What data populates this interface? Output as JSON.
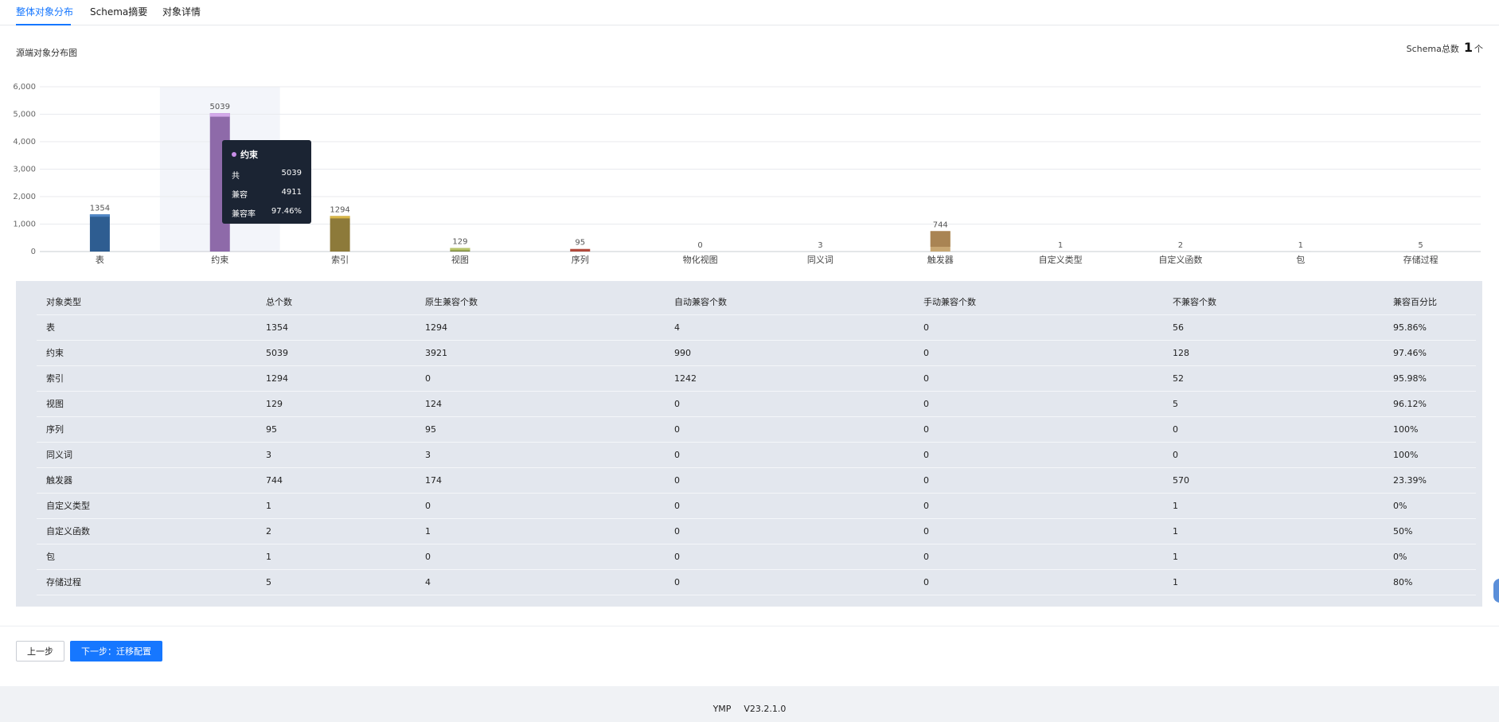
{
  "tabs": [
    {
      "label": "整体对象分布",
      "active": true
    },
    {
      "label": "Schema摘要",
      "active": false
    },
    {
      "label": "对象详情",
      "active": false
    }
  ],
  "chart_header": {
    "title": "源端对象分布图",
    "schema_total_label": "Schema总数",
    "schema_total_value": "1",
    "schema_total_unit": "个"
  },
  "chart_data": {
    "type": "bar",
    "categories": [
      "表",
      "约束",
      "索引",
      "视图",
      "序列",
      "物化视图",
      "同义词",
      "触发器",
      "自定义类型",
      "自定义函数",
      "包",
      "存储过程"
    ],
    "values": [
      1354,
      5039,
      1294,
      129,
      95,
      0,
      3,
      744,
      1,
      2,
      1,
      5
    ],
    "compatible": [
      1298,
      4911,
      1242,
      124,
      95,
      0,
      3,
      174,
      0,
      1,
      0,
      4
    ],
    "yticks": [
      "0",
      "1,000",
      "2,000",
      "3,000",
      "4,000",
      "5,000",
      "6,000"
    ],
    "ylim": [
      0,
      6000
    ],
    "colors": [
      "#2e5d91",
      "#8e6aa9",
      "#8d7a3a",
      "#7d8a44",
      "#b24a3c",
      "#9aa1aa",
      "#9aa1aa",
      "#c8a772",
      "#9aa1aa",
      "#9aa1aa",
      "#9aa1aa",
      "#9aa1aa"
    ],
    "top_colors": [
      "#4f86c6",
      "#d3a9ea",
      "#d8b648",
      "#b8c46a",
      "#e07a5f",
      "#9aa1aa",
      "#9aa1aa",
      "#a98453",
      "#9aa1aa",
      "#9aa1aa",
      "#9aa1aa",
      "#9aa1aa"
    ],
    "highlight_index": 1
  },
  "tooltip": {
    "title": "约束",
    "rows": [
      {
        "label": "共",
        "value": "5039"
      },
      {
        "label": "兼容",
        "value": "4911"
      },
      {
        "label": "兼容率",
        "value": "97.46%"
      }
    ]
  },
  "table": {
    "headers": [
      "对象类型",
      "总个数",
      "原生兼容个数",
      "自动兼容个数",
      "手动兼容个数",
      "不兼容个数",
      "兼容百分比"
    ],
    "rows": [
      [
        "表",
        "1354",
        "1294",
        "4",
        "0",
        "56",
        "95.86%"
      ],
      [
        "约束",
        "5039",
        "3921",
        "990",
        "0",
        "128",
        "97.46%"
      ],
      [
        "索引",
        "1294",
        "0",
        "1242",
        "0",
        "52",
        "95.98%"
      ],
      [
        "视图",
        "129",
        "124",
        "0",
        "0",
        "5",
        "96.12%"
      ],
      [
        "序列",
        "95",
        "95",
        "0",
        "0",
        "0",
        "100%"
      ],
      [
        "同义词",
        "3",
        "3",
        "0",
        "0",
        "0",
        "100%"
      ],
      [
        "触发器",
        "744",
        "174",
        "0",
        "0",
        "570",
        "23.39%"
      ],
      [
        "自定义类型",
        "1",
        "0",
        "0",
        "0",
        "1",
        "0%"
      ],
      [
        "自定义函数",
        "2",
        "1",
        "0",
        "0",
        "1",
        "50%"
      ],
      [
        "包",
        "1",
        "0",
        "0",
        "0",
        "1",
        "0%"
      ],
      [
        "存储过程",
        "5",
        "4",
        "0",
        "0",
        "1",
        "80%"
      ]
    ]
  },
  "footer": {
    "prev_label": "上一步",
    "next_label": "下一步：迁移配置",
    "product": "YMP",
    "version": "V23.2.1.0"
  }
}
